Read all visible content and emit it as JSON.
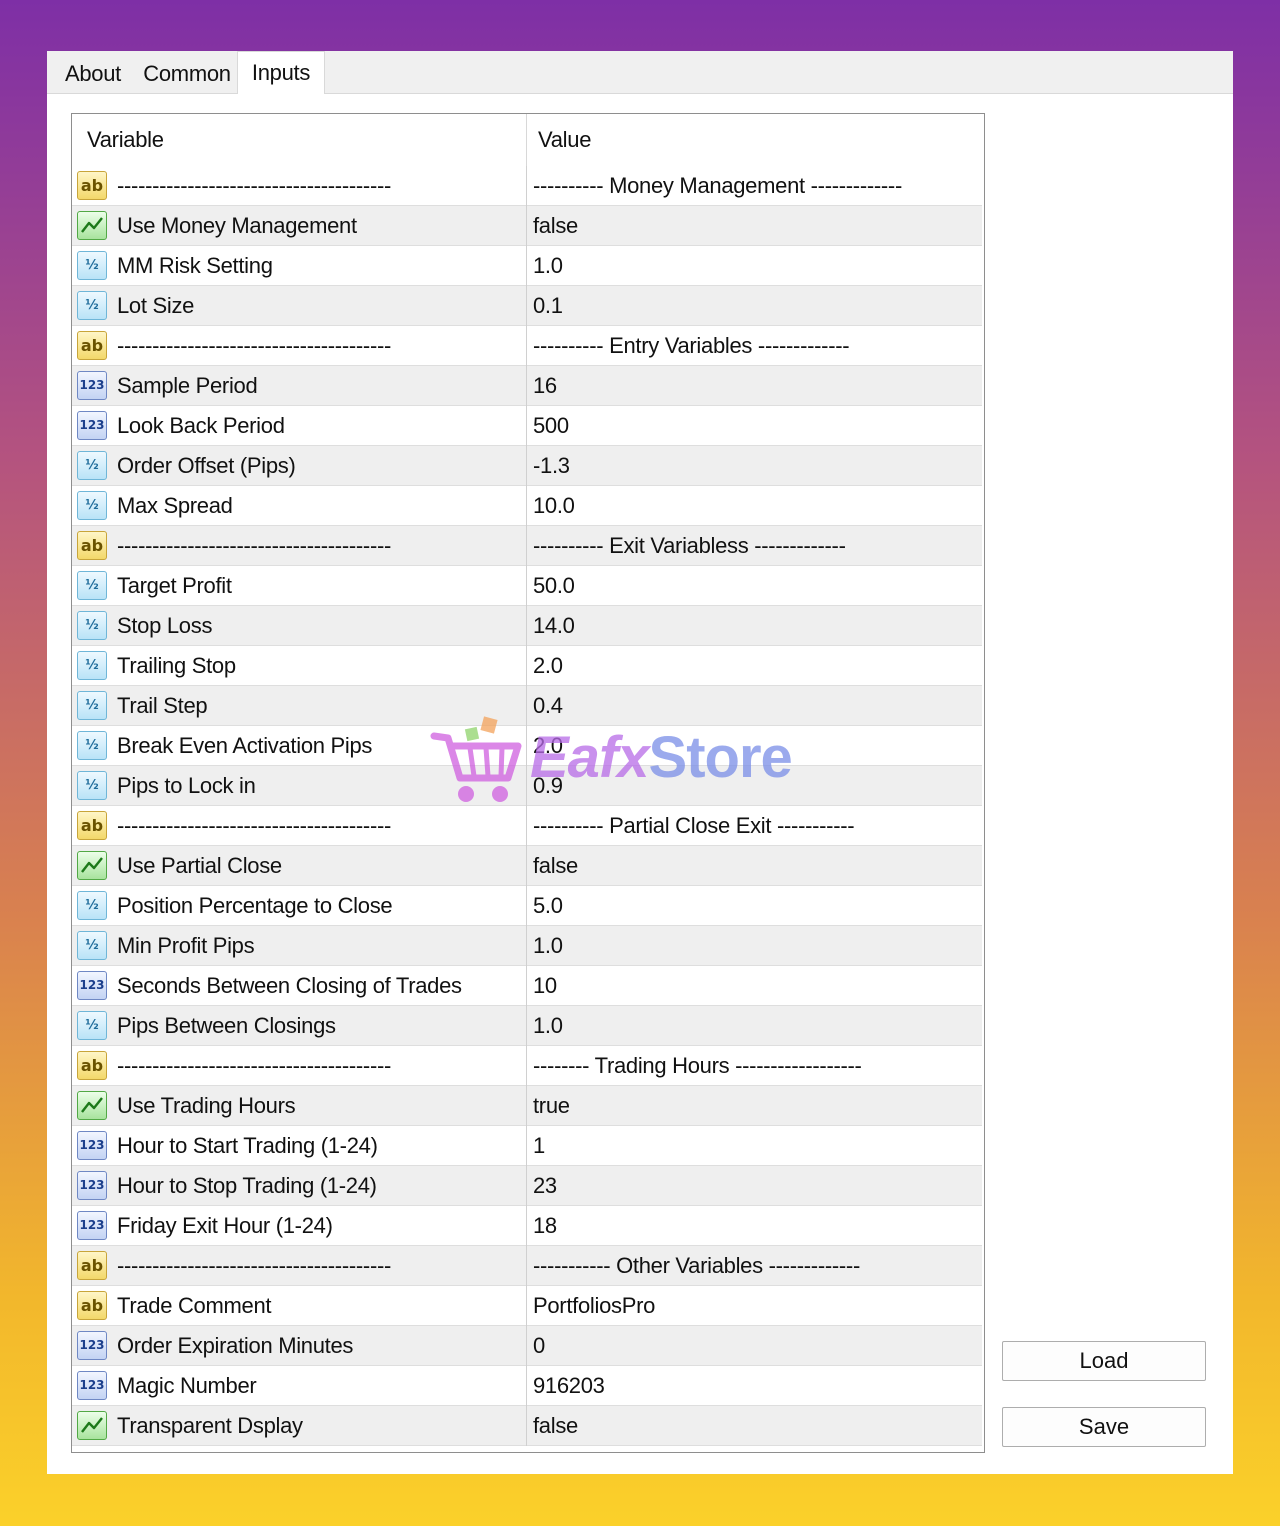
{
  "tabs": [
    {
      "label": "About",
      "active": false
    },
    {
      "label": "Common",
      "active": false
    },
    {
      "label": "Inputs",
      "active": true
    }
  ],
  "grid": {
    "headers": {
      "variable": "Variable",
      "value": "Value"
    },
    "rows": [
      {
        "icon": "ab",
        "variable": "---------------------------------------",
        "value": "---------- Money Management -------------"
      },
      {
        "icon": "bool",
        "variable": "Use Money Management",
        "value": "false"
      },
      {
        "icon": "half",
        "variable": "MM Risk Setting",
        "value": "1.0"
      },
      {
        "icon": "half",
        "variable": "Lot Size",
        "value": "0.1"
      },
      {
        "icon": "ab",
        "variable": "---------------------------------------",
        "value": "---------- Entry Variables -------------"
      },
      {
        "icon": "num",
        "variable": "Sample Period",
        "value": "16"
      },
      {
        "icon": "num",
        "variable": "Look Back Period",
        "value": "500"
      },
      {
        "icon": "half",
        "variable": "Order Offset (Pips)",
        "value": "-1.3"
      },
      {
        "icon": "half",
        "variable": "Max Spread",
        "value": "10.0"
      },
      {
        "icon": "ab",
        "variable": "---------------------------------------",
        "value": "---------- Exit Variabless -------------"
      },
      {
        "icon": "half",
        "variable": "Target Profit",
        "value": "50.0"
      },
      {
        "icon": "half",
        "variable": "Stop Loss",
        "value": "14.0"
      },
      {
        "icon": "half",
        "variable": "Trailing Stop",
        "value": "2.0"
      },
      {
        "icon": "half",
        "variable": "Trail Step",
        "value": "0.4"
      },
      {
        "icon": "half",
        "variable": "Break Even Activation Pips",
        "value": "2.0"
      },
      {
        "icon": "half",
        "variable": "Pips to Lock in",
        "value": "0.9"
      },
      {
        "icon": "ab",
        "variable": "---------------------------------------",
        "value": "---------- Partial Close Exit -----------"
      },
      {
        "icon": "bool",
        "variable": "Use Partial Close",
        "value": "false"
      },
      {
        "icon": "half",
        "variable": "Position Percentage to Close",
        "value": "5.0"
      },
      {
        "icon": "half",
        "variable": "Min Profit Pips",
        "value": "1.0"
      },
      {
        "icon": "num",
        "variable": "Seconds Between Closing of Trades",
        "value": "10"
      },
      {
        "icon": "half",
        "variable": "Pips Between Closings",
        "value": "1.0"
      },
      {
        "icon": "ab",
        "variable": "---------------------------------------",
        "value": "-------- Trading Hours ------------------"
      },
      {
        "icon": "bool",
        "variable": "Use Trading Hours",
        "value": "true"
      },
      {
        "icon": "num",
        "variable": "Hour to Start Trading (1-24)",
        "value": "1"
      },
      {
        "icon": "num",
        "variable": "Hour to Stop Trading (1-24)",
        "value": "23"
      },
      {
        "icon": "num",
        "variable": "Friday Exit Hour (1-24)",
        "value": "18"
      },
      {
        "icon": "ab",
        "variable": "---------------------------------------",
        "value": "----------- Other Variables -------------"
      },
      {
        "icon": "ab",
        "variable": "Trade Comment",
        "value": "PortfoliosPro"
      },
      {
        "icon": "num",
        "variable": "Order Expiration Minutes",
        "value": "0"
      },
      {
        "icon": "num",
        "variable": "Magic Number",
        "value": "916203"
      },
      {
        "icon": "bool",
        "variable": "Transparent Dsplay",
        "value": "false"
      }
    ]
  },
  "buttons": {
    "load_label": "Load",
    "save_label": "Save"
  },
  "watermark": {
    "part1": "Eafx",
    "part2": "Store"
  },
  "icon_glyphs": {
    "ab": "ab",
    "half": "½",
    "num": "123"
  },
  "colors": {
    "selection_shade": "#efefef",
    "grid_border": "#8e8e8e"
  }
}
